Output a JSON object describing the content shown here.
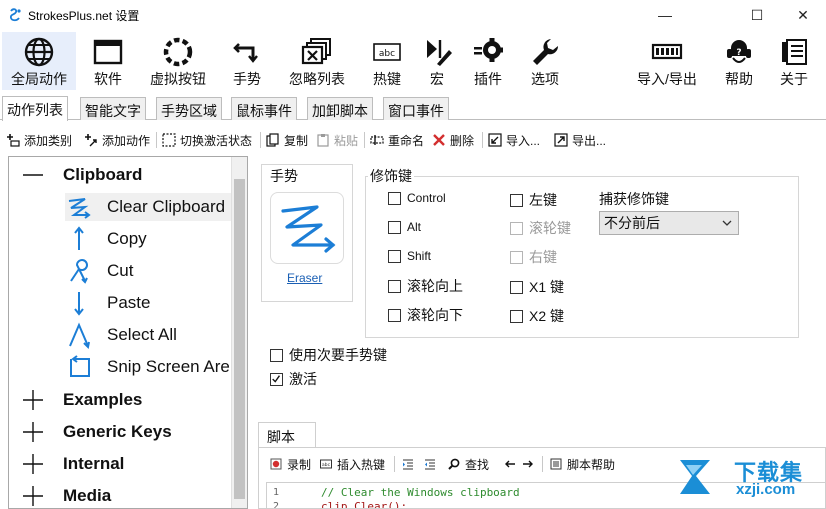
{
  "window": {
    "title": "StrokesPlus.net 设置",
    "minimize": "—",
    "maximize": "☐",
    "close": "✕"
  },
  "main_toolbar": {
    "items": [
      {
        "label": "全局动作",
        "icon": "globe-icon"
      },
      {
        "label": "软件",
        "icon": "window-icon"
      },
      {
        "label": "虚拟按钮",
        "icon": "dashed-circle-icon"
      },
      {
        "label": "手势",
        "icon": "gesture-arrow-icon"
      },
      {
        "label": "忽略列表",
        "icon": "ignore-windows-icon"
      },
      {
        "label": "热键",
        "icon": "hotkey-icon"
      },
      {
        "label": "宏",
        "icon": "macro-icon"
      },
      {
        "label": "插件",
        "icon": "plugin-gear-icon"
      },
      {
        "label": "选项",
        "icon": "wrench-icon"
      },
      {
        "label": "导入/导出",
        "icon": "import-export-icon"
      },
      {
        "label": "帮助",
        "icon": "help-icon"
      },
      {
        "label": "关于",
        "icon": "about-icon"
      }
    ]
  },
  "tabs": [
    {
      "label": "动作列表"
    },
    {
      "label": "智能文字"
    },
    {
      "label": "手势区域"
    },
    {
      "label": "鼠标事件"
    },
    {
      "label": "加卸脚本"
    },
    {
      "label": "窗口事件"
    }
  ],
  "sub_toolbar": {
    "add_category": "添加类别",
    "add_action": "添加动作",
    "toggle_activation": "切换激活状态",
    "copy": "复制",
    "paste": "粘贴",
    "rename": "重命名",
    "delete": "删除",
    "import": "导入...",
    "export": "导出..."
  },
  "tree": {
    "groups": [
      {
        "label": "Clipboard",
        "expanded": true
      },
      {
        "label": "Examples"
      },
      {
        "label": "Generic Keys"
      },
      {
        "label": "Internal"
      },
      {
        "label": "Media"
      }
    ],
    "items": [
      {
        "label": "Clear Clipboard",
        "icon": "zigzag-gesture-icon"
      },
      {
        "label": "Copy",
        "icon": "arrow-up-gesture-icon"
      },
      {
        "label": "Cut",
        "icon": "loop-gesture-icon"
      },
      {
        "label": "Paste",
        "icon": "arrow-down-gesture-icon"
      },
      {
        "label": "Select All",
        "icon": "caret-gesture-icon"
      },
      {
        "label": "Snip Screen Are",
        "icon": "square-gesture-icon"
      }
    ]
  },
  "gesture": {
    "title": "手势",
    "name": "Eraser"
  },
  "modifiers": {
    "title": "修饰键",
    "left": [
      {
        "label": "Control"
      },
      {
        "label": "Alt"
      },
      {
        "label": "Shift"
      },
      {
        "label": "滚轮向上"
      },
      {
        "label": "滚轮向下"
      }
    ],
    "right": [
      {
        "label": "左键"
      },
      {
        "label": "滚轮键"
      },
      {
        "label": "右键"
      },
      {
        "label": "X1 键"
      },
      {
        "label": "X2 键"
      }
    ],
    "capture_label": "捕获修饰键",
    "capture_value": "不分前后"
  },
  "options": {
    "use_secondary": "使用次要手势键",
    "activate": "激活"
  },
  "script": {
    "tab": "脚本",
    "record": "录制",
    "insert_hotkey": "插入热键",
    "find": "查找",
    "script_help": "脚本帮助",
    "lines": [
      {
        "num": "1",
        "text": "// Clear the Windows clipboard"
      },
      {
        "num": "2",
        "text": "clip.Clear();"
      }
    ]
  },
  "watermark": {
    "text": "下载集",
    "url": "xzji.com"
  },
  "colors": {
    "accent_blue": "#1a77d2",
    "gesture_blue": "#1c7ed6",
    "selection": "#e7eefb",
    "record_red": "#d32f2f",
    "delete_red": "#d32f2f"
  }
}
